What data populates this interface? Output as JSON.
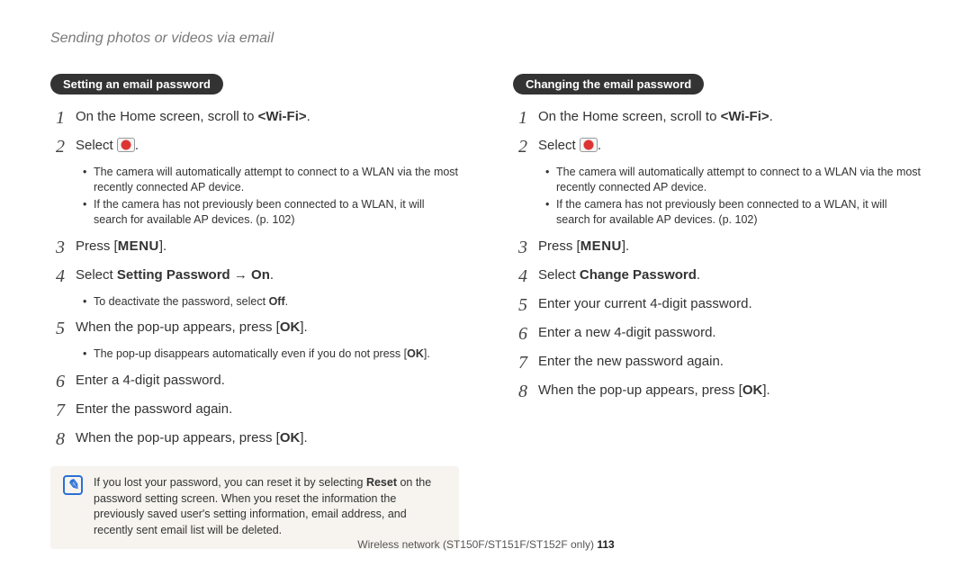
{
  "header": "Sending photos or videos via email",
  "left": {
    "pill": "Setting an email password",
    "step1_pre": "On the Home screen, scroll to ",
    "step1_bold": "<Wi-Fi>",
    "step1_post": ".",
    "step2": "Select ",
    "step2_post": ".",
    "sub2a": "The camera will automatically attempt to connect to a WLAN via the most recently connected AP device.",
    "sub2b": "If the camera has not previously been connected to a WLAN, it will search for available AP devices. (p. 102)",
    "step3_pre": "Press [",
    "step3_menu": "MENU",
    "step3_post": "].",
    "step4_pre": "Select ",
    "step4_bold": "Setting Password → On",
    "step4_post": ".",
    "sub4a_pre": "To deactivate the password, select ",
    "sub4a_bold": "Off",
    "sub4a_post": ".",
    "step5_pre": "When the pop-up appears, press [",
    "step5_ok": "OK",
    "step5_post": "].",
    "sub5a_pre": "The pop-up disappears automatically even if you do not press [",
    "sub5a_ok": "OK",
    "sub5a_post": "].",
    "step6": "Enter a 4-digit password.",
    "step7": "Enter the password again.",
    "step8_pre": "When the pop-up appears, press [",
    "step8_ok": "OK",
    "step8_post": "]."
  },
  "right": {
    "pill": "Changing the email password",
    "step1_pre": "On the Home screen, scroll to ",
    "step1_bold": "<Wi-Fi>",
    "step1_post": ".",
    "step2": "Select ",
    "step2_post": ".",
    "sub2a": "The camera will automatically attempt to connect to a WLAN via the most recently connected AP device.",
    "sub2b": "If the camera has not previously been connected to a WLAN, it will search for available AP devices. (p. 102)",
    "step3_pre": "Press [",
    "step3_menu": "MENU",
    "step3_post": "].",
    "step4_pre": "Select ",
    "step4_bold": "Change Password",
    "step4_post": ".",
    "step5": "Enter your current 4-digit password.",
    "step6": "Enter a new 4-digit password.",
    "step7": "Enter the new password again.",
    "step8_pre": "When the pop-up appears, press [",
    "step8_ok": "OK",
    "step8_post": "]."
  },
  "note": {
    "pre": "If you lost your password, you can reset it by selecting ",
    "bold": "Reset",
    "post": " on the password setting screen. When you reset the information the previously saved user's setting information, email address, and recently sent email list will be deleted."
  },
  "footer": {
    "text": "Wireless network  (ST150F/ST151F/ST152F only)  ",
    "page": "113"
  },
  "nums": {
    "n1": "1",
    "n2": "2",
    "n3": "3",
    "n4": "4",
    "n5": "5",
    "n6": "6",
    "n7": "7",
    "n8": "8"
  }
}
